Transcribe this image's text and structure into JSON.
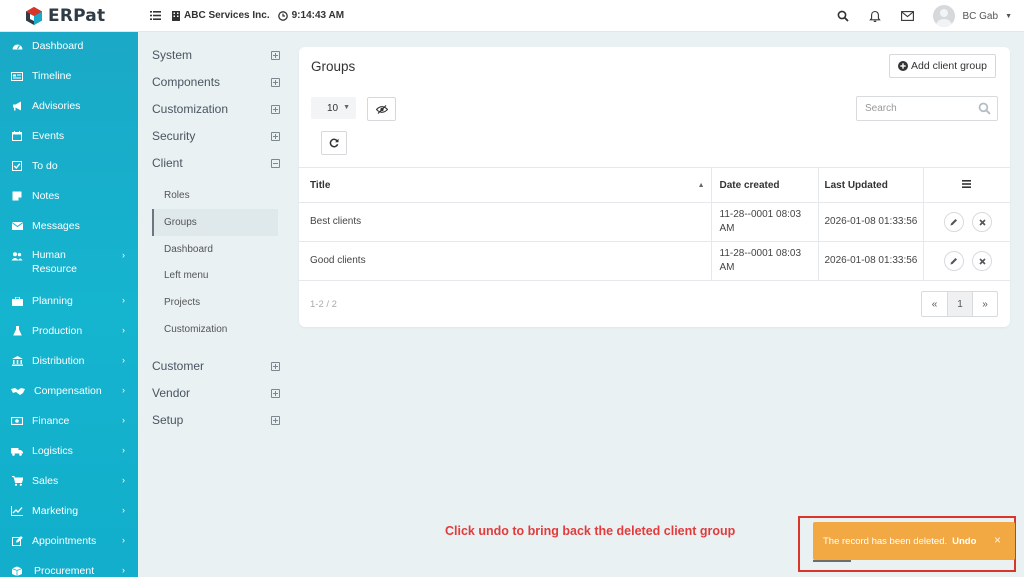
{
  "topbar": {
    "brand": "ERPat",
    "company": "ABC Services Inc.",
    "time": "9:14:43 AM",
    "user_name": "BC Gab"
  },
  "sidebar": {
    "items": [
      {
        "label": "Dashboard",
        "icon": "dashboard-icon",
        "has_children": false
      },
      {
        "label": "Timeline",
        "icon": "timeline-icon",
        "has_children": false
      },
      {
        "label": "Advisories",
        "icon": "megaphone-icon",
        "has_children": false
      },
      {
        "label": "Events",
        "icon": "calendar-icon",
        "has_children": false
      },
      {
        "label": "To do",
        "icon": "checkbox-icon",
        "has_children": false
      },
      {
        "label": "Notes",
        "icon": "note-icon",
        "has_children": false
      },
      {
        "label": "Messages",
        "icon": "envelope-icon",
        "has_children": false
      },
      {
        "label": "Human Resource",
        "icon": "users-icon",
        "has_children": true
      },
      {
        "label": "Planning",
        "icon": "briefcase-icon",
        "has_children": true
      },
      {
        "label": "Production",
        "icon": "flask-icon",
        "has_children": true
      },
      {
        "label": "Distribution",
        "icon": "bank-icon",
        "has_children": true
      },
      {
        "label": "Compensation",
        "icon": "handshake-icon",
        "has_children": true
      },
      {
        "label": "Finance",
        "icon": "money-icon",
        "has_children": true
      },
      {
        "label": "Logistics",
        "icon": "truck-icon",
        "has_children": true
      },
      {
        "label": "Sales",
        "icon": "cart-icon",
        "has_children": true
      },
      {
        "label": "Marketing",
        "icon": "chart-line-icon",
        "has_children": true
      },
      {
        "label": "Appointments",
        "icon": "edit-icon",
        "has_children": true
      },
      {
        "label": "Procurement",
        "icon": "box-icon",
        "has_children": true
      }
    ]
  },
  "settings_nav": {
    "sections": [
      {
        "label": "System",
        "expanded": false
      },
      {
        "label": "Components",
        "expanded": false
      },
      {
        "label": "Customization",
        "expanded": false
      },
      {
        "label": "Security",
        "expanded": false
      },
      {
        "label": "Client",
        "expanded": true
      },
      {
        "label": "Customer",
        "expanded": false
      },
      {
        "label": "Vendor",
        "expanded": false
      },
      {
        "label": "Setup",
        "expanded": false
      }
    ],
    "client_sub_items": [
      "Roles",
      "Groups",
      "Dashboard",
      "Left menu",
      "Projects",
      "Customization"
    ],
    "active_sub_item": "Groups"
  },
  "groups": {
    "title": "Groups",
    "add_button_label": "Add client group",
    "page_size": "10",
    "search_placeholder": "Search",
    "columns": {
      "title": "Title",
      "date_created": "Date created",
      "last_updated": "Last Updated"
    },
    "rows": [
      {
        "title": "Best clients",
        "date_created": "11-28--0001 08:03 AM",
        "last_updated": "2026-01-08 01:33:56"
      },
      {
        "title": "Good clients",
        "date_created": "11-28--0001 08:03 AM",
        "last_updated": "2026-01-08 01:33:56"
      }
    ],
    "pagination": {
      "summary": "1-2 / 2",
      "prev": "«",
      "current": "1",
      "next": "»"
    }
  },
  "annotation": "Click undo to bring back the deleted client group",
  "toast": {
    "message": "The record has been deleted.",
    "undo_label": "Undo",
    "close": "×"
  },
  "colors": {
    "sidebar": "#15b4cf",
    "toast": "#f2a944",
    "annotation": "#e23b3b",
    "highlight_border": "#d9352b"
  }
}
